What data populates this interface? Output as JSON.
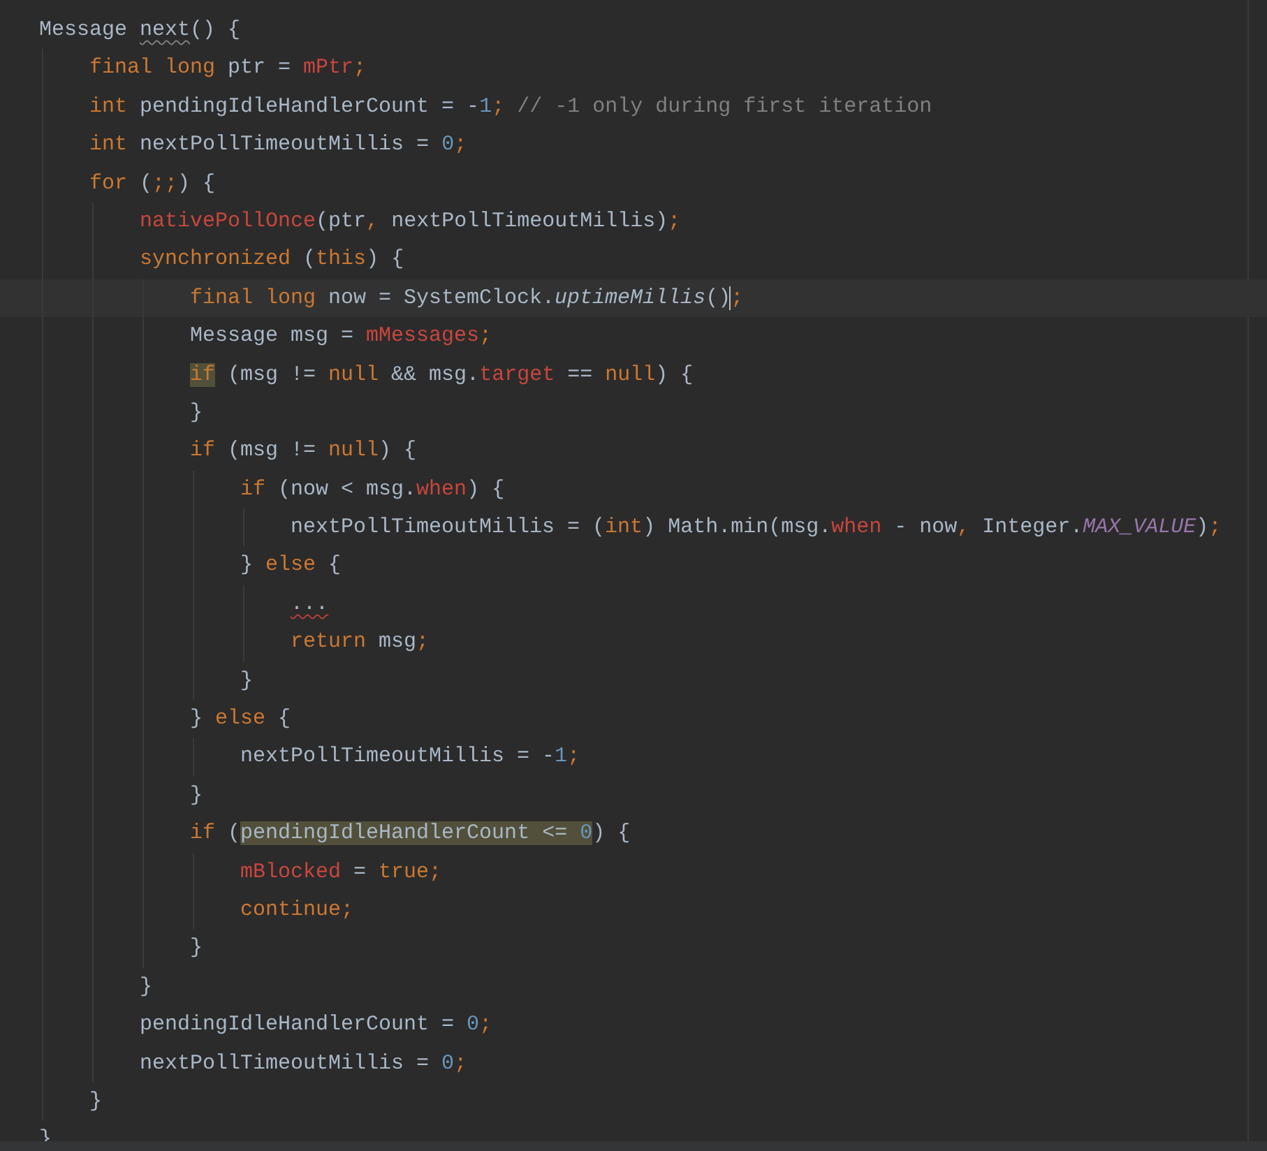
{
  "editor": {
    "lines": [
      {
        "current": false,
        "tokens": [
          {
            "text": "Message ",
            "kind": "plain"
          },
          {
            "text": "next",
            "kind": "plain",
            "warning": true
          },
          {
            "text": "() {",
            "kind": "plain"
          }
        ],
        "children": [
          {
            "current": false,
            "tokens": [
              {
                "text": "final long",
                "kind": "keyword"
              },
              {
                "text": " ptr = ",
                "kind": "plain"
              },
              {
                "text": "mPtr",
                "kind": "field"
              },
              {
                "text": ";",
                "kind": "punct"
              }
            ]
          },
          {
            "current": false,
            "tokens": [
              {
                "text": "int",
                "kind": "keyword"
              },
              {
                "text": " pendingIdleHandlerCount = -",
                "kind": "plain"
              },
              {
                "text": "1",
                "kind": "number"
              },
              {
                "text": ";",
                "kind": "punct"
              },
              {
                "text": " // -1 only during first iteration",
                "kind": "comment"
              }
            ]
          },
          {
            "current": false,
            "tokens": [
              {
                "text": "int",
                "kind": "keyword"
              },
              {
                "text": " nextPollTimeoutMillis = ",
                "kind": "plain"
              },
              {
                "text": "0",
                "kind": "number"
              },
              {
                "text": ";",
                "kind": "punct"
              }
            ]
          },
          {
            "current": false,
            "tokens": [
              {
                "text": "for",
                "kind": "keyword"
              },
              {
                "text": " (",
                "kind": "plain"
              },
              {
                "text": ";;",
                "kind": "punct"
              },
              {
                "text": ") {",
                "kind": "plain"
              }
            ],
            "children": [
              {
                "current": false,
                "tokens": [
                  {
                    "text": "nativePollOnce",
                    "kind": "field"
                  },
                  {
                    "text": "(ptr",
                    "kind": "plain"
                  },
                  {
                    "text": ", ",
                    "kind": "punct"
                  },
                  {
                    "text": "nextPollTimeoutMillis)",
                    "kind": "plain"
                  },
                  {
                    "text": ";",
                    "kind": "punct"
                  }
                ]
              },
              {
                "current": false,
                "tokens": [
                  {
                    "text": "synchronized",
                    "kind": "keyword"
                  },
                  {
                    "text": " (",
                    "kind": "plain"
                  },
                  {
                    "text": "this",
                    "kind": "keyword"
                  },
                  {
                    "text": ") {",
                    "kind": "plain"
                  }
                ],
                "children": [
                  {
                    "current": true,
                    "tokens": [
                      {
                        "text": "final long",
                        "kind": "keyword"
                      },
                      {
                        "text": " now = SystemClock.",
                        "kind": "plain"
                      },
                      {
                        "text": "uptimeMillis",
                        "kind": "static_method"
                      },
                      {
                        "text": "()",
                        "kind": "plain",
                        "caret_after": true
                      },
                      {
                        "text": ";",
                        "kind": "punct"
                      }
                    ]
                  },
                  {
                    "current": false,
                    "tokens": [
                      {
                        "text": "Message msg = ",
                        "kind": "plain"
                      },
                      {
                        "text": "mMessages",
                        "kind": "field"
                      },
                      {
                        "text": ";",
                        "kind": "punct"
                      }
                    ]
                  },
                  {
                    "current": false,
                    "tokens": [
                      {
                        "text": "if",
                        "kind": "keyword",
                        "highlighted": true
                      },
                      {
                        "text": " (msg != ",
                        "kind": "plain"
                      },
                      {
                        "text": "null",
                        "kind": "keyword"
                      },
                      {
                        "text": " && msg.",
                        "kind": "plain"
                      },
                      {
                        "text": "target",
                        "kind": "field"
                      },
                      {
                        "text": " == ",
                        "kind": "plain"
                      },
                      {
                        "text": "null",
                        "kind": "keyword"
                      },
                      {
                        "text": ") {",
                        "kind": "plain"
                      }
                    ]
                  },
                  {
                    "current": false,
                    "tokens": [
                      {
                        "text": "}",
                        "kind": "plain"
                      }
                    ]
                  },
                  {
                    "current": false,
                    "tokens": [
                      {
                        "text": "if",
                        "kind": "keyword"
                      },
                      {
                        "text": " (msg != ",
                        "kind": "plain"
                      },
                      {
                        "text": "null",
                        "kind": "keyword"
                      },
                      {
                        "text": ") {",
                        "kind": "plain"
                      }
                    ],
                    "children": [
                      {
                        "current": false,
                        "tokens": [
                          {
                            "text": "if",
                            "kind": "keyword"
                          },
                          {
                            "text": " (now < msg.",
                            "kind": "plain"
                          },
                          {
                            "text": "when",
                            "kind": "field"
                          },
                          {
                            "text": ") {",
                            "kind": "plain"
                          }
                        ],
                        "children": [
                          {
                            "current": false,
                            "tokens": [
                              {
                                "text": "nextPollTimeoutMillis = (",
                                "kind": "plain"
                              },
                              {
                                "text": "int",
                                "kind": "keyword"
                              },
                              {
                                "text": ") Math.min(msg.",
                                "kind": "plain"
                              },
                              {
                                "text": "when",
                                "kind": "field"
                              },
                              {
                                "text": " - now",
                                "kind": "plain"
                              },
                              {
                                "text": ", ",
                                "kind": "punct"
                              },
                              {
                                "text": "Integer.",
                                "kind": "plain"
                              },
                              {
                                "text": "MAX_VALUE",
                                "kind": "constant"
                              },
                              {
                                "text": ")",
                                "kind": "plain"
                              },
                              {
                                "text": ";",
                                "kind": "punct"
                              }
                            ]
                          }
                        ]
                      },
                      {
                        "current": false,
                        "tokens": [
                          {
                            "text": "} ",
                            "kind": "plain"
                          },
                          {
                            "text": "else",
                            "kind": "keyword"
                          },
                          {
                            "text": " {",
                            "kind": "plain"
                          }
                        ],
                        "children": [
                          {
                            "current": false,
                            "tokens": [
                              {
                                "text": "...",
                                "kind": "plain",
                                "error": true
                              }
                            ]
                          },
                          {
                            "current": false,
                            "tokens": [
                              {
                                "text": "return",
                                "kind": "keyword"
                              },
                              {
                                "text": " msg",
                                "kind": "plain"
                              },
                              {
                                "text": ";",
                                "kind": "punct"
                              }
                            ]
                          }
                        ]
                      },
                      {
                        "current": false,
                        "tokens": [
                          {
                            "text": "}",
                            "kind": "plain"
                          }
                        ]
                      }
                    ]
                  },
                  {
                    "current": false,
                    "tokens": [
                      {
                        "text": "} ",
                        "kind": "plain"
                      },
                      {
                        "text": "else",
                        "kind": "keyword"
                      },
                      {
                        "text": " {",
                        "kind": "plain"
                      }
                    ],
                    "children": [
                      {
                        "current": false,
                        "tokens": [
                          {
                            "text": "nextPollTimeoutMillis = -",
                            "kind": "plain"
                          },
                          {
                            "text": "1",
                            "kind": "number"
                          },
                          {
                            "text": ";",
                            "kind": "punct"
                          }
                        ]
                      }
                    ]
                  },
                  {
                    "current": false,
                    "tokens": [
                      {
                        "text": "}",
                        "kind": "plain"
                      }
                    ]
                  },
                  {
                    "current": false,
                    "tokens": [
                      {
                        "text": "if",
                        "kind": "keyword"
                      },
                      {
                        "text": " (",
                        "kind": "plain"
                      },
                      {
                        "text": "pendingIdleHandlerCount <= ",
                        "kind": "plain",
                        "highlighted": true
                      },
                      {
                        "text": "0",
                        "kind": "number",
                        "highlighted": true
                      },
                      {
                        "text": ") {",
                        "kind": "plain"
                      }
                    ],
                    "children": [
                      {
                        "current": false,
                        "tokens": [
                          {
                            "text": "mBlocked",
                            "kind": "field"
                          },
                          {
                            "text": " = ",
                            "kind": "plain"
                          },
                          {
                            "text": "true",
                            "kind": "keyword"
                          },
                          {
                            "text": ";",
                            "kind": "punct"
                          }
                        ]
                      },
                      {
                        "current": false,
                        "tokens": [
                          {
                            "text": "continue",
                            "kind": "keyword"
                          },
                          {
                            "text": ";",
                            "kind": "punct"
                          }
                        ]
                      }
                    ]
                  },
                  {
                    "current": false,
                    "tokens": [
                      {
                        "text": "}",
                        "kind": "plain"
                      }
                    ]
                  }
                ]
              },
              {
                "current": false,
                "tokens": [
                  {
                    "text": "}",
                    "kind": "plain"
                  }
                ]
              },
              {
                "current": false,
                "tokens": [
                  {
                    "text": "pendingIdleHandlerCount = ",
                    "kind": "plain"
                  },
                  {
                    "text": "0",
                    "kind": "number"
                  },
                  {
                    "text": ";",
                    "kind": "punct"
                  }
                ]
              },
              {
                "current": false,
                "tokens": [
                  {
                    "text": "nextPollTimeoutMillis = ",
                    "kind": "plain"
                  },
                  {
                    "text": "0",
                    "kind": "number"
                  },
                  {
                    "text": ";",
                    "kind": "punct"
                  }
                ]
              }
            ]
          },
          {
            "current": false,
            "tokens": [
              {
                "text": "}",
                "kind": "plain"
              }
            ]
          }
        ]
      },
      {
        "current": false,
        "tokens": [
          {
            "text": "}",
            "kind": "plain"
          }
        ]
      }
    ]
  }
}
